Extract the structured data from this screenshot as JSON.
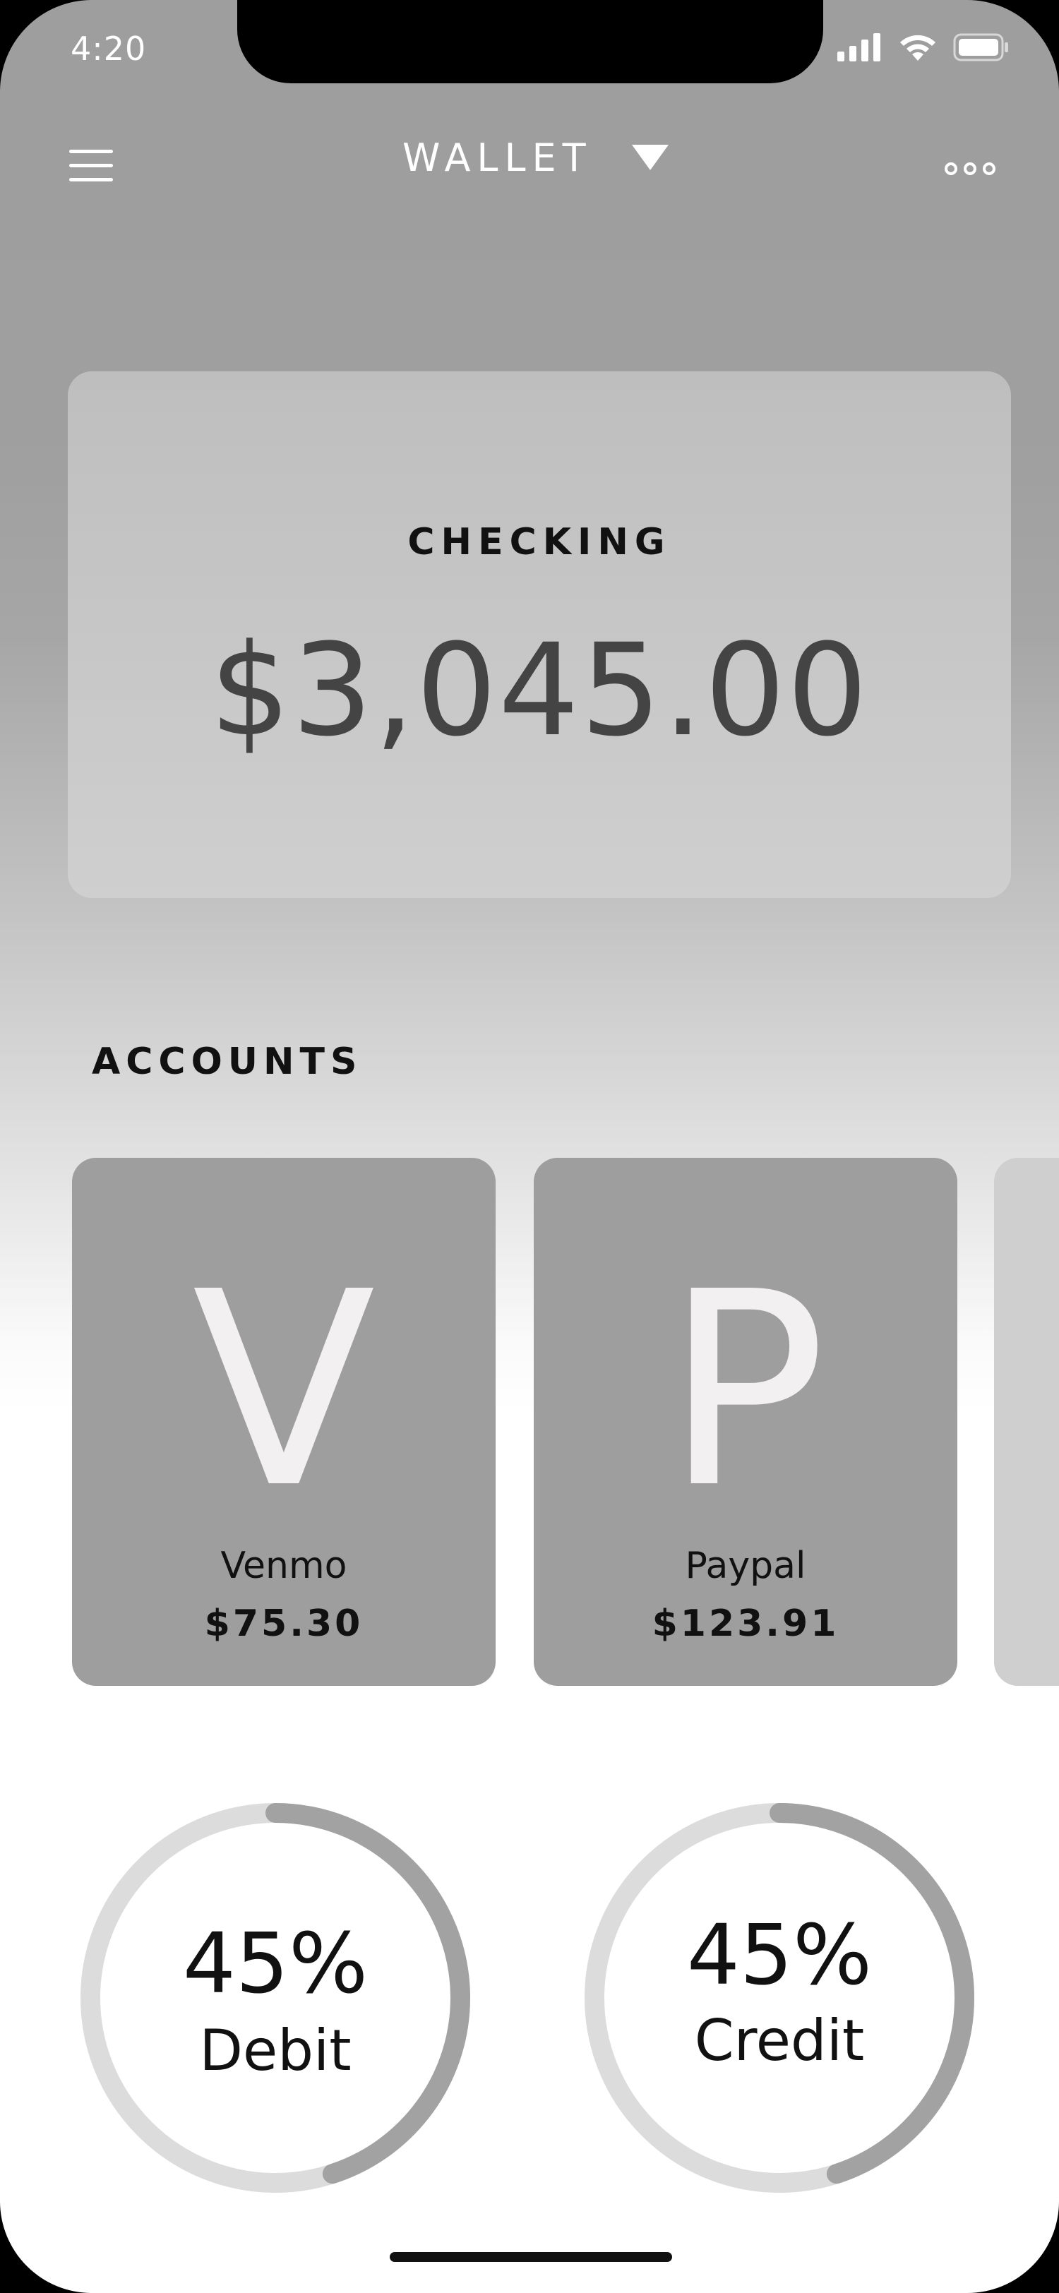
{
  "status_bar": {
    "time": "4:20",
    "icons": [
      "signal-icon",
      "wifi-icon",
      "battery-icon"
    ]
  },
  "nav": {
    "menu_icon": "hamburger-menu-icon",
    "title": "WALLET",
    "dropdown_icon": "triangle-down-icon",
    "more_icon": "more-dots-icon"
  },
  "balance": {
    "label": "CHECKING",
    "amount": "$3,045.00"
  },
  "accounts": {
    "title": "ACCOUNTS",
    "items": [
      {
        "letter": "V",
        "name": "Venmo",
        "amount": "$75.30"
      },
      {
        "letter": "P",
        "name": "Paypal",
        "amount": "$123.91"
      }
    ]
  },
  "gauges": [
    {
      "percent_text": "45%",
      "label": "Debit",
      "fraction": 0.45
    },
    {
      "percent_text": "45%",
      "label": "Credit",
      "fraction": 0.45
    }
  ],
  "colors": {
    "gauge_track": "#dcdcdc",
    "gauge_fill": "#a2a2a2",
    "card_bg": "#9e9e9e"
  }
}
